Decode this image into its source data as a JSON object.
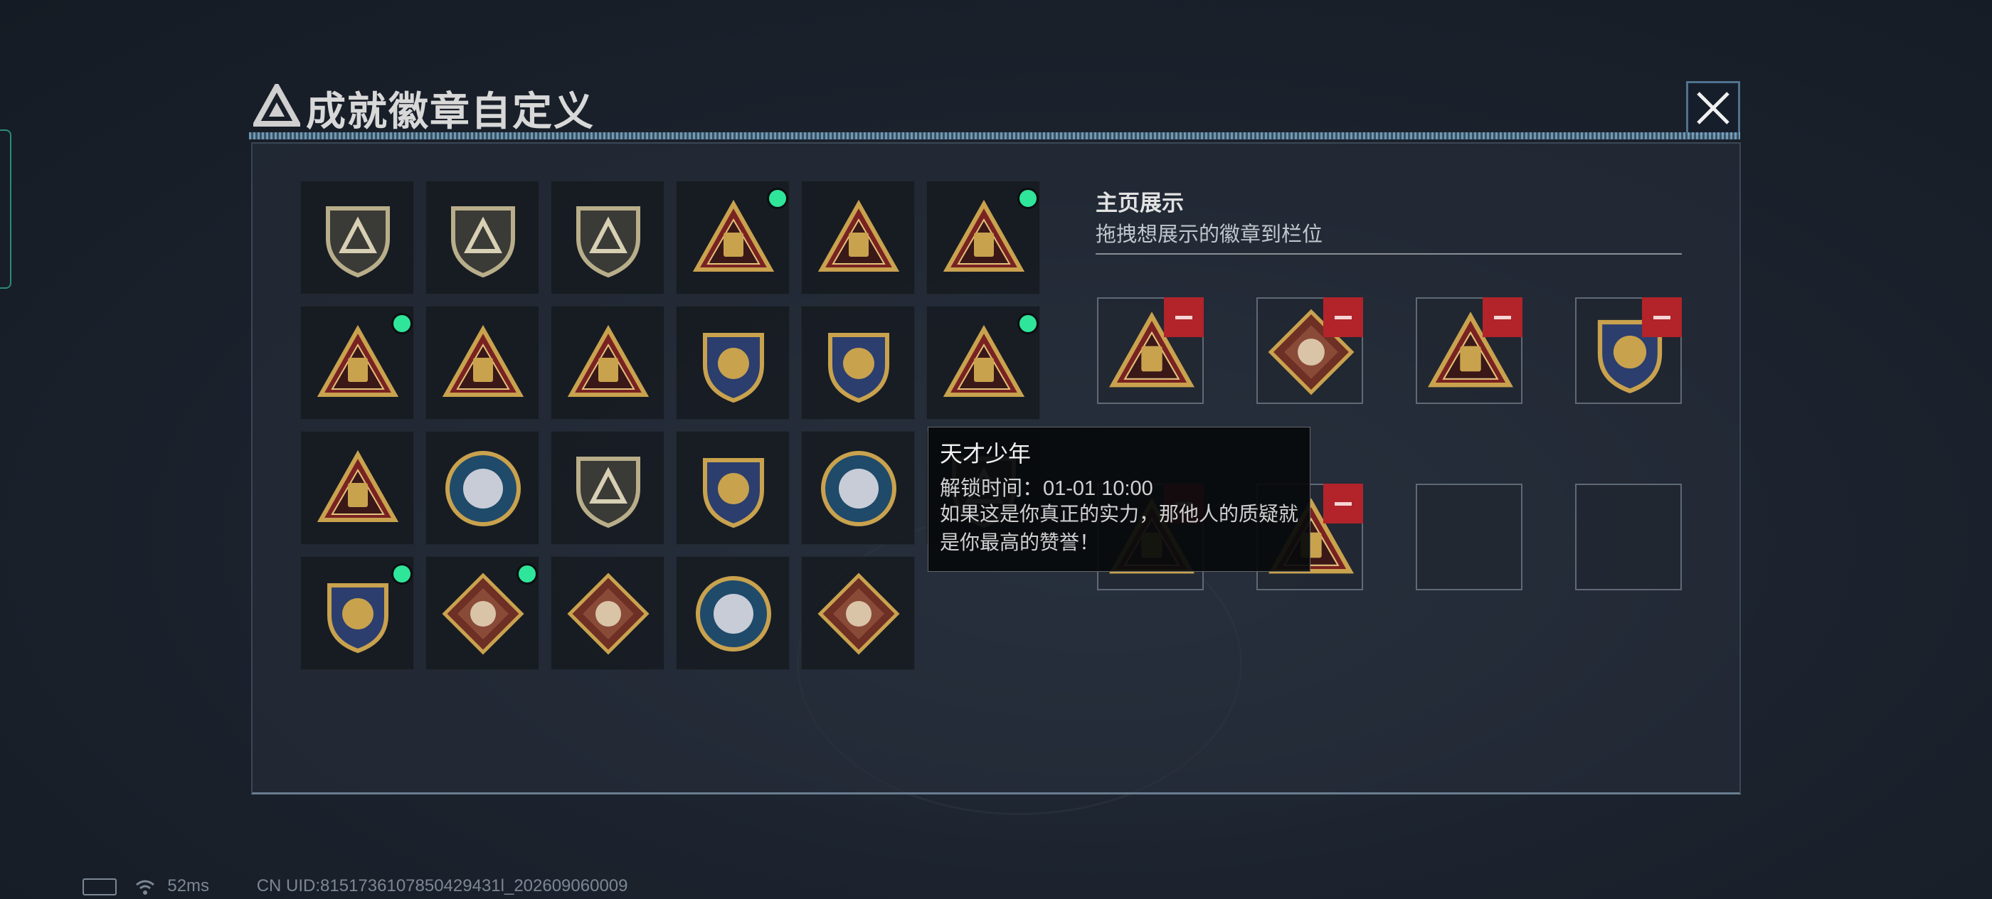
{
  "title": "成就徽章自定义",
  "title_small": "",
  "showcase": {
    "heading": "主页展示",
    "subheading": "拖拽想展示的徽章到栏位"
  },
  "tooltip": {
    "name": "天才少年",
    "unlock_time": "解锁时间：01-01 10:00",
    "description": "如果这是你真正的实力，那他人的质疑就是你最高的赞誉！"
  },
  "badges": [
    {
      "icon": "delta-shield-badge-icon",
      "new": false
    },
    {
      "icon": "helicopter-shield-badge-icon",
      "new": false
    },
    {
      "icon": "dagger-shield-badge-icon",
      "new": false
    },
    {
      "icon": "canister-57-triangle-badge-icon",
      "new": true
    },
    {
      "icon": "canister-59-triangle-badge-icon",
      "new": false
    },
    {
      "icon": "grenade-cluster-triangle-badge-icon",
      "new": true
    },
    {
      "icon": "boat-triangle-badge-icon",
      "new": true
    },
    {
      "icon": "number-1-triangle-badge-icon",
      "new": false
    },
    {
      "icon": "number-2-triangle-badge-icon",
      "new": false
    },
    {
      "icon": "delta-force-tank-badge-icon",
      "new": false
    },
    {
      "icon": "delta-force-2026-badge-icon",
      "new": false
    },
    {
      "icon": "usb-drive-triangle-badge-icon",
      "new": true
    },
    {
      "icon": "soldiers-triangle-badge-icon",
      "new": false
    },
    {
      "icon": "star-medal-badge-icon",
      "new": false
    },
    {
      "icon": "wing-shield-badge-icon",
      "new": false
    },
    {
      "icon": "stars-crest-badge-icon",
      "new": false
    },
    {
      "icon": "silver-skull-badge-icon",
      "new": false
    },
    {
      "icon": "no-gun-shield-badge-icon",
      "new": false
    },
    {
      "icon": "crossed-sword-crest-badge-icon",
      "new": true
    },
    {
      "icon": "wolf-diamond-badge-icon",
      "new": true
    },
    {
      "icon": "dragon-diamond-badge-icon",
      "new": false
    },
    {
      "icon": "wolf-round-badge-icon",
      "new": false
    },
    {
      "icon": "horse-diamond-badge-icon",
      "new": false
    }
  ],
  "slots": [
    {
      "icon": "canister-57-triangle-badge-icon",
      "filled": true
    },
    {
      "icon": "wolf-diamond-badge-icon",
      "filled": true
    },
    {
      "icon": "usb-drive-triangle-badge-icon",
      "filled": true
    },
    {
      "icon": "crossed-sword-crest-badge-icon",
      "filled": true
    },
    {
      "icon": "boat-triangle-badge-icon",
      "filled": true
    },
    {
      "icon": "grenade-cluster-triangle-badge-icon",
      "filled": true
    },
    {
      "icon": "",
      "filled": false
    },
    {
      "icon": "",
      "filled": false
    }
  ],
  "status_bar": {
    "ping": "52ms",
    "uid": "CN UID:8151736107850429431l_202609060009"
  },
  "colors": {
    "new_dot": "#2fe59a",
    "remove_button": "#b2232a",
    "gold": "#c9a24e"
  }
}
